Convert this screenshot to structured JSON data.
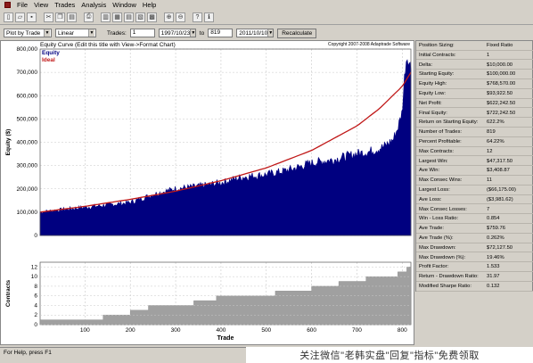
{
  "menu": [
    "File",
    "View",
    "Trades",
    "Analysis",
    "Window",
    "Help"
  ],
  "toolbar_icons": [
    "new-icon",
    "open-icon",
    "save-icon",
    "cut-icon",
    "copy-icon",
    "paste-icon",
    "print-icon",
    "chart-icon",
    "table-icon",
    "summary-icon",
    "report-icon",
    "grid-icon",
    "zoom-in-icon",
    "zoom-out-icon",
    "help-icon",
    "about-icon"
  ],
  "controls": {
    "plot_by": "Plot by Trade",
    "scale": "Linear",
    "trades_label": "Trades:",
    "trades_from": "1",
    "date_from": "1997/10/23",
    "to_label": "to",
    "trades_to": "819",
    "date_to": "2011/10/10",
    "recalc": "Recalculate"
  },
  "chart": {
    "title": "Equity Curve (Edit this title with View->Format Chart)",
    "copyright": "Copyright 2007-2008 Adaptrade Software",
    "legend_equity": "Equity",
    "legend_ideal": "Ideal",
    "ylabel": "Equity ($)",
    "ylabel2": "Contracts",
    "xlabel": "Trade",
    "colors": {
      "equity": "#000080",
      "ideal": "#c01818",
      "contracts": "#a0a0a0"
    }
  },
  "chart_data": {
    "type": "area",
    "title": "Equity Curve (Edit this title with View->Format Chart)",
    "xlabel": "Trade",
    "ylabel": "Equity ($)",
    "xlim": [
      1,
      819
    ],
    "ylim": [
      0,
      800000
    ],
    "xticks": [
      100,
      200,
      300,
      400,
      500,
      600,
      700,
      800
    ],
    "yticks": [
      0,
      100000,
      200000,
      300000,
      400000,
      500000,
      600000,
      700000,
      800000
    ],
    "ytick_labels": [
      "0",
      "100,000",
      "200,000",
      "300,000",
      "400,000",
      "500,000",
      "600,000",
      "700,000",
      "800,000"
    ],
    "grid": true,
    "legend": "top-left",
    "series": [
      {
        "name": "Equity",
        "x": [
          1,
          50,
          100,
          150,
          200,
          250,
          300,
          350,
          400,
          450,
          500,
          550,
          600,
          650,
          700,
          730,
          760,
          780,
          790,
          800,
          805,
          810,
          815,
          819
        ],
        "values": [
          100000,
          110000,
          120000,
          130000,
          140000,
          175000,
          200000,
          210000,
          225000,
          250000,
          260000,
          280000,
          310000,
          325000,
          350000,
          360000,
          380000,
          410000,
          460000,
          530000,
          680000,
          768570,
          740000,
          722242
        ]
      },
      {
        "name": "Ideal",
        "x": [
          1,
          100,
          200,
          300,
          400,
          500,
          600,
          700,
          750,
          800,
          819
        ],
        "values": [
          100000,
          125000,
          155000,
          190000,
          235000,
          290000,
          365000,
          470000,
          545000,
          640000,
          700000
        ]
      }
    ],
    "contracts": {
      "ylabel": "Contracts",
      "ylim": [
        0,
        13
      ],
      "yticks": [
        0,
        2,
        4,
        6,
        8,
        10,
        12
      ],
      "x": [
        1,
        80,
        140,
        170,
        200,
        240,
        290,
        340,
        390,
        450,
        520,
        600,
        660,
        720,
        760,
        790,
        810,
        819
      ],
      "values": [
        1,
        1,
        2,
        2,
        3,
        4,
        4,
        5,
        6,
        6,
        7,
        8,
        9,
        10,
        10,
        11,
        12,
        12
      ]
    }
  },
  "stats": [
    [
      "Position Sizing:",
      "Fixed Ratio"
    ],
    [
      "Initial Contracts:",
      "1"
    ],
    [
      "Delta:",
      "$10,000.00"
    ],
    [
      "Starting Equity:",
      "$100,000.00"
    ],
    [
      "Equity High:",
      "$768,570.00"
    ],
    [
      "Equity Low:",
      "$93,922.50"
    ],
    [
      "Net Profit:",
      "$622,242.50"
    ],
    [
      "Final Equity:",
      "$722,242.50"
    ],
    [
      "Return on Starting Equity:",
      "622.2%"
    ],
    [
      "Number of Trades:",
      "819"
    ],
    [
      "Percent Profitable:",
      "64.22%"
    ],
    [
      "Max Contracts:",
      "12"
    ],
    [
      "Largest Win:",
      "$47,317.50"
    ],
    [
      "Ave Win:",
      "$3,408.87"
    ],
    [
      "Max Consec Wins:",
      "11"
    ],
    [
      "Largest Loss:",
      "($66,175.00)"
    ],
    [
      "Ave Loss:",
      "($3,981.62)"
    ],
    [
      "Max Consec Losses:",
      "7"
    ],
    [
      "Win - Loss Ratio:",
      "0.854"
    ],
    [
      "Ave Trade:",
      "$759.76"
    ],
    [
      "Ave Trade (%):",
      "0.262%"
    ],
    [
      "Max Drawdown:",
      "$72,127.50"
    ],
    [
      "Max Drawdown (%):",
      "19.46%"
    ],
    [
      "Profit Factor:",
      "1.533"
    ],
    [
      "Return - Drawdown Ratio:",
      "31.97"
    ],
    [
      "Modified Sharpe Ratio:",
      "0.132"
    ]
  ],
  "status": "For Help, press F1",
  "watermark": "关注微信\"老韩实盘\"回复\"指标\"免费领取"
}
